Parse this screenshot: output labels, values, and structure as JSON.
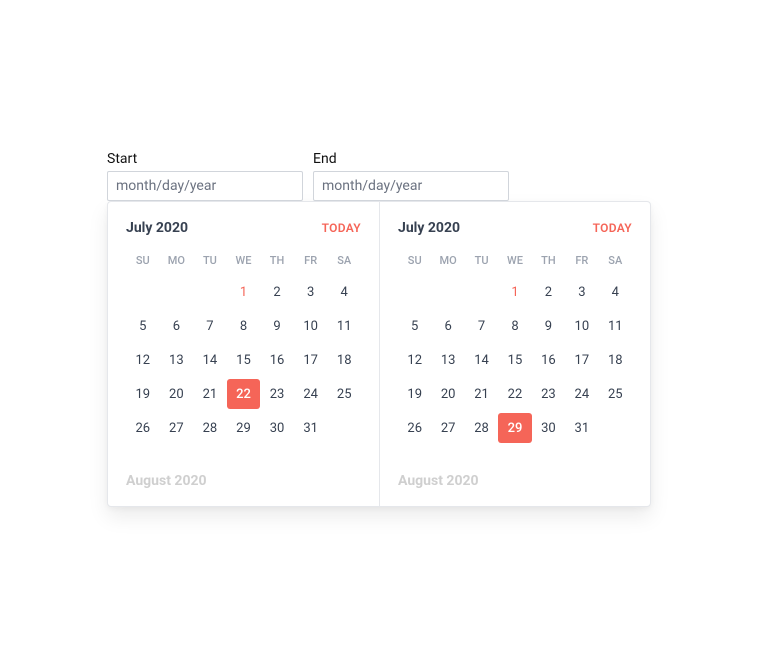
{
  "accent": "#f56558",
  "inputs": {
    "start": {
      "label": "Start",
      "placeholder": "month/day/year",
      "value": ""
    },
    "end": {
      "label": "End",
      "placeholder": "month/day/year",
      "value": ""
    }
  },
  "day_headers": [
    "SU",
    "MO",
    "TU",
    "WE",
    "TH",
    "FR",
    "SA"
  ],
  "today_label": "TODAY",
  "calendars": [
    {
      "title": "July 2020",
      "lead_blanks": 3,
      "days_in_month": 31,
      "today": 1,
      "selected": 22,
      "next_month_title": "August 2020"
    },
    {
      "title": "July 2020",
      "lead_blanks": 3,
      "days_in_month": 31,
      "today": 1,
      "selected": 29,
      "next_month_title": "August 2020"
    }
  ]
}
